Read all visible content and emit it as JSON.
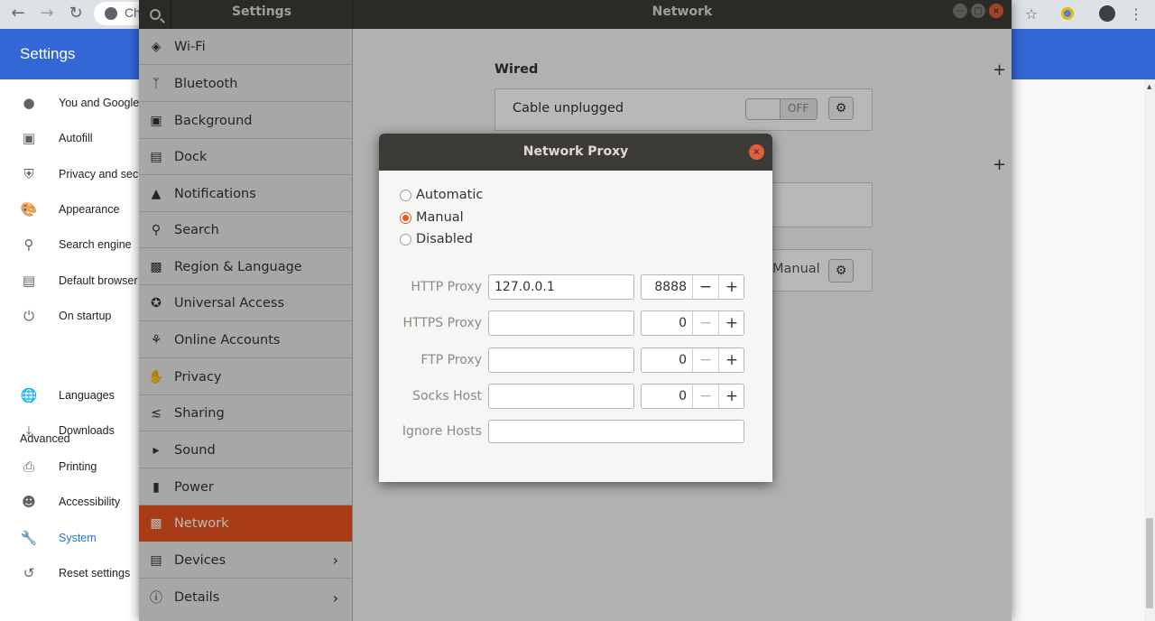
{
  "chrome": {
    "tab_title_fragment": "Ch",
    "header_title": "Settings",
    "nav": [
      {
        "label": "You and Google",
        "icon": "person-icon"
      },
      {
        "label": "Autofill",
        "icon": "clipboard-icon"
      },
      {
        "label": "Privacy and security",
        "icon": "shield-icon"
      },
      {
        "label": "Appearance",
        "icon": "palette-icon"
      },
      {
        "label": "Search engine",
        "icon": "search-icon"
      },
      {
        "label": "Default browser",
        "icon": "browser-icon"
      },
      {
        "label": "On startup",
        "icon": "power-icon"
      }
    ],
    "advanced_label": "Advanced",
    "advanced_nav": [
      {
        "label": "Languages",
        "icon": "globe-icon"
      },
      {
        "label": "Downloads",
        "icon": "download-icon"
      },
      {
        "label": "Printing",
        "icon": "printer-icon"
      },
      {
        "label": "Accessibility",
        "icon": "accessibility-icon"
      },
      {
        "label": "System",
        "icon": "wrench-icon",
        "active": true
      },
      {
        "label": "Reset settings",
        "icon": "reset-icon"
      }
    ]
  },
  "settings_window": {
    "left_title": "Settings",
    "title": "Network",
    "sidebar": [
      {
        "label": "Wi-Fi",
        "icon": "wifi-icon"
      },
      {
        "label": "Bluetooth",
        "icon": "bluetooth-icon"
      },
      {
        "label": "Background",
        "icon": "background-icon"
      },
      {
        "label": "Dock",
        "icon": "dock-icon"
      },
      {
        "label": "Notifications",
        "icon": "bell-icon"
      },
      {
        "label": "Search",
        "icon": "search-icon"
      },
      {
        "label": "Region & Language",
        "icon": "region-icon"
      },
      {
        "label": "Universal Access",
        "icon": "universal-access-icon"
      },
      {
        "label": "Online Accounts",
        "icon": "online-accounts-icon"
      },
      {
        "label": "Privacy",
        "icon": "hand-icon"
      },
      {
        "label": "Sharing",
        "icon": "share-icon"
      },
      {
        "label": "Sound",
        "icon": "speaker-icon"
      },
      {
        "label": "Power",
        "icon": "battery-icon"
      },
      {
        "label": "Network",
        "icon": "network-icon",
        "active": true
      },
      {
        "label": "Devices",
        "icon": "devices-icon",
        "chevron": true
      },
      {
        "label": "Details",
        "icon": "info-icon",
        "chevron": true
      }
    ],
    "wired": {
      "title": "Wired",
      "status": "Cable unplugged",
      "switch_label": "OFF"
    },
    "proxy_row_value": "Manual"
  },
  "dialog": {
    "title": "Network Proxy",
    "modes": [
      {
        "label": "Automatic",
        "selected": false
      },
      {
        "label": "Manual",
        "selected": true
      },
      {
        "label": "Disabled",
        "selected": false
      }
    ],
    "proxies": [
      {
        "label": "HTTP Proxy",
        "host": "127.0.0.1",
        "port": "8888",
        "minus_enabled": true
      },
      {
        "label": "HTTPS Proxy",
        "host": "",
        "port": "0",
        "minus_enabled": false
      },
      {
        "label": "FTP Proxy",
        "host": "",
        "port": "0",
        "minus_enabled": false
      },
      {
        "label": "Socks Host",
        "host": "",
        "port": "0",
        "minus_enabled": false
      }
    ],
    "ignore_hosts_label": "Ignore Hosts",
    "ignore_hosts_value": ""
  },
  "colors": {
    "accent": "#e95420",
    "chrome_blue": "#3367d6",
    "titlebar": "#3c3b37"
  }
}
